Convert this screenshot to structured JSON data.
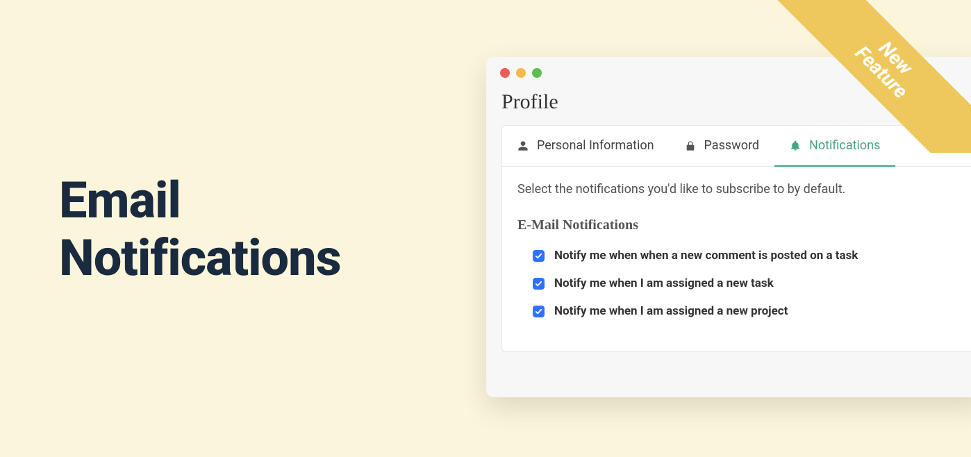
{
  "hero": {
    "title_line1": "Email",
    "title_line2": "Notifications"
  },
  "ribbon": {
    "line1": "New",
    "line2": "Feature"
  },
  "window": {
    "title": "Profile",
    "tabs": [
      {
        "label": "Personal Information",
        "icon": "user-icon",
        "active": false
      },
      {
        "label": "Password",
        "icon": "lock-icon",
        "active": false
      },
      {
        "label": "Notifications",
        "icon": "bell-icon",
        "active": true
      }
    ],
    "description": "Select the notifications you'd like to subscribe to by default.",
    "section_heading": "E-Mail Notifications",
    "options": [
      {
        "label": "Notify me when when a new comment is posted on a task",
        "checked": true
      },
      {
        "label": "Notify me when I am assigned a new task",
        "checked": true
      },
      {
        "label": "Notify me when I am assigned a new project",
        "checked": true
      }
    ]
  },
  "colors": {
    "background": "#fbf5db",
    "hero_text": "#1a2b3f",
    "ribbon": "#eec85d",
    "accent_green": "#42a583",
    "checkbox_blue": "#2f72ff"
  }
}
